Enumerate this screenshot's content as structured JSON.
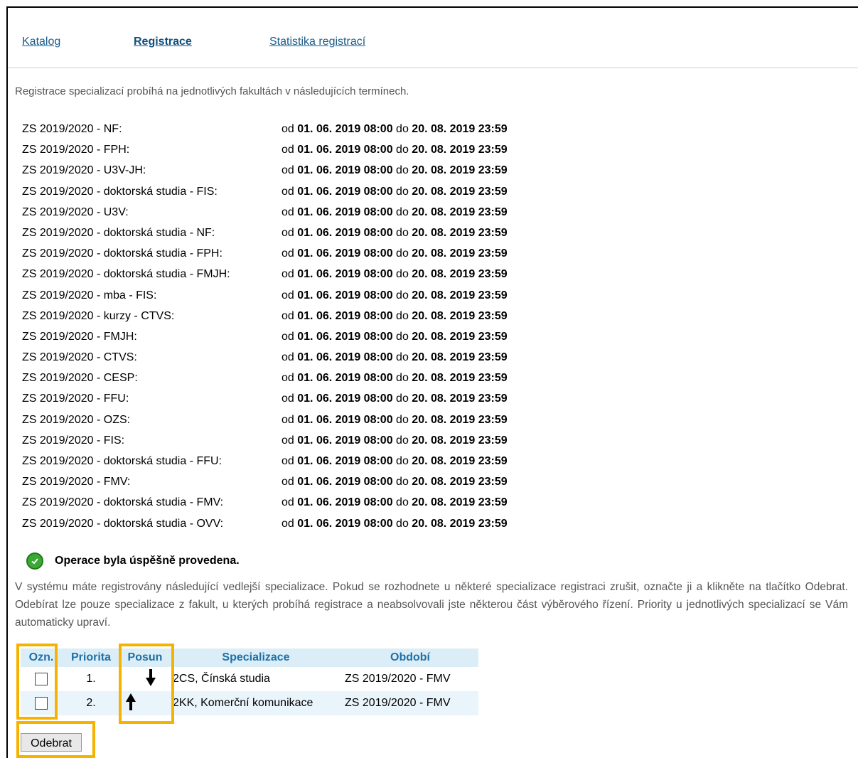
{
  "nav": {
    "items": [
      {
        "label": "Katalog"
      },
      {
        "label": "Registrace"
      },
      {
        "label": "Statistika registrací"
      }
    ]
  },
  "intro": "Registrace specializací probíhá na jednotlivých fakultách v následujících termínech.",
  "terms": {
    "from_word": "od",
    "to_word": "do",
    "items": [
      {
        "name": "ZS 2019/2020 - NF:",
        "from": "01. 06. 2019 08:00",
        "to": "20. 08. 2019 23:59"
      },
      {
        "name": "ZS 2019/2020 - FPH:",
        "from": "01. 06. 2019 08:00",
        "to": "20. 08. 2019 23:59"
      },
      {
        "name": "ZS 2019/2020 - U3V-JH:",
        "from": "01. 06. 2019 08:00",
        "to": "20. 08. 2019 23:59"
      },
      {
        "name": "ZS 2019/2020 - doktorská studia - FIS:",
        "from": "01. 06. 2019 08:00",
        "to": "20. 08. 2019 23:59"
      },
      {
        "name": "ZS 2019/2020 - U3V:",
        "from": "01. 06. 2019 08:00",
        "to": "20. 08. 2019 23:59"
      },
      {
        "name": "ZS 2019/2020 - doktorská studia - NF:",
        "from": "01. 06. 2019 08:00",
        "to": "20. 08. 2019 23:59"
      },
      {
        "name": "ZS 2019/2020 - doktorská studia - FPH:",
        "from": "01. 06. 2019 08:00",
        "to": "20. 08. 2019 23:59"
      },
      {
        "name": "ZS 2019/2020 - doktorská studia - FMJH:",
        "from": "01. 06. 2019 08:00",
        "to": "20. 08. 2019 23:59"
      },
      {
        "name": "ZS 2019/2020 - mba - FIS:",
        "from": "01. 06. 2019 08:00",
        "to": "20. 08. 2019 23:59"
      },
      {
        "name": "ZS 2019/2020 - kurzy - CTVS:",
        "from": "01. 06. 2019 08:00",
        "to": "20. 08. 2019 23:59"
      },
      {
        "name": "ZS 2019/2020 - FMJH:",
        "from": "01. 06. 2019 08:00",
        "to": "20. 08. 2019 23:59"
      },
      {
        "name": "ZS 2019/2020 - CTVS:",
        "from": "01. 06. 2019 08:00",
        "to": "20. 08. 2019 23:59"
      },
      {
        "name": "ZS 2019/2020 - CESP:",
        "from": "01. 06. 2019 08:00",
        "to": "20. 08. 2019 23:59"
      },
      {
        "name": "ZS 2019/2020 - FFU:",
        "from": "01. 06. 2019 08:00",
        "to": "20. 08. 2019 23:59"
      },
      {
        "name": "ZS 2019/2020 - OZS:",
        "from": "01. 06. 2019 08:00",
        "to": "20. 08. 2019 23:59"
      },
      {
        "name": "ZS 2019/2020 - FIS:",
        "from": "01. 06. 2019 08:00",
        "to": "20. 08. 2019 23:59"
      },
      {
        "name": "ZS 2019/2020 - doktorská studia - FFU:",
        "from": "01. 06. 2019 08:00",
        "to": "20. 08. 2019 23:59"
      },
      {
        "name": "ZS 2019/2020 - FMV:",
        "from": "01. 06. 2019 08:00",
        "to": "20. 08. 2019 23:59"
      },
      {
        "name": "ZS 2019/2020 - doktorská studia - FMV:",
        "from": "01. 06. 2019 08:00",
        "to": "20. 08. 2019 23:59"
      },
      {
        "name": "ZS 2019/2020 - doktorská studia - OVV:",
        "from": "01. 06. 2019 08:00",
        "to": "20. 08. 2019 23:59"
      }
    ]
  },
  "success": {
    "icon": "check-circle-icon",
    "message": "Operace byla úspěšně provedena."
  },
  "info": "V systému máte registrovány následující vedlejší specializace. Pokud se rozhodnete u některé specializace registraci zrušit, označte ji a klikněte na tlačítko Odebrat. Odebírat lze pouze specializace z fakult, u kterých probíhá registrace a neabsolvovali jste některou část výběrového řízení. Priority u jednotlivých specializací se Vám automaticky upraví.",
  "table": {
    "headers": {
      "mark": "Ozn.",
      "priority": "Priorita",
      "move": "Posun",
      "spec": "Specializace",
      "period": "Období"
    },
    "rows": [
      {
        "checked": false,
        "priority": "1.",
        "move_icon": "arrow-down-icon",
        "spec": "2CS, Čínská studia",
        "period": "ZS 2019/2020 - FMV"
      },
      {
        "checked": false,
        "priority": "2.",
        "move_icon": "arrow-up-icon",
        "spec": "2KK, Komerční komunikace",
        "period": "ZS 2019/2020 - FMV"
      }
    ]
  },
  "remove_button": {
    "label": "Odebrat"
  },
  "colors": {
    "highlight": "#f5b300",
    "link": "#1a5c8a",
    "header_bg": "#dbeef8",
    "header_text": "#1f6fa6",
    "success": "#3aa935"
  }
}
